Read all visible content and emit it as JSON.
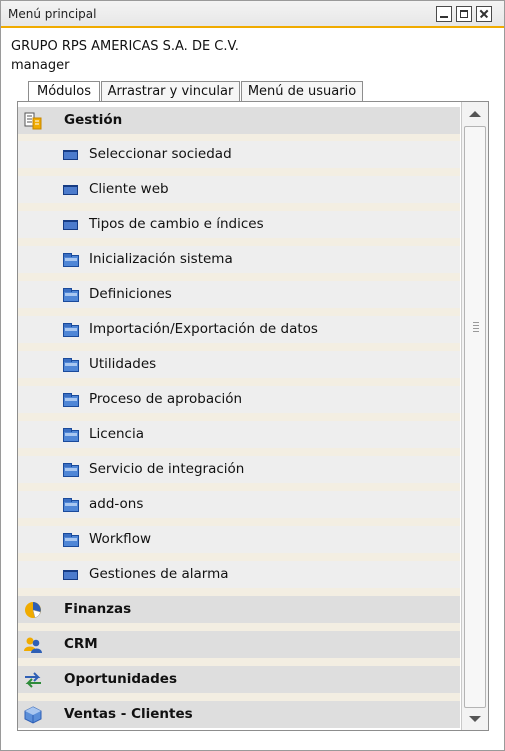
{
  "window": {
    "title": "Menú principal",
    "company": "GRUPO RPS AMERICAS S.A. DE C.V.",
    "user": "manager"
  },
  "tabs": [
    {
      "label": "Módulos",
      "active": true
    },
    {
      "label": "Arrastrar y vincular",
      "active": false
    },
    {
      "label": "Menú de usuario",
      "active": false
    }
  ],
  "modules": {
    "gestion": {
      "label": "Gestión",
      "items": [
        {
          "label": "Seleccionar sociedad",
          "icon": "window-icon"
        },
        {
          "label": "Cliente web",
          "icon": "window-icon"
        },
        {
          "label": "Tipos de cambio e índices",
          "icon": "window-icon"
        },
        {
          "label": "Inicialización sistema",
          "icon": "folder-icon"
        },
        {
          "label": "Definiciones",
          "icon": "folder-icon"
        },
        {
          "label": "Importación/Exportación de datos",
          "icon": "folder-icon"
        },
        {
          "label": "Utilidades",
          "icon": "folder-icon"
        },
        {
          "label": "Proceso de aprobación",
          "icon": "folder-icon"
        },
        {
          "label": "Licencia",
          "icon": "folder-icon"
        },
        {
          "label": "Servicio de integración",
          "icon": "folder-icon"
        },
        {
          "label": "add-ons",
          "icon": "folder-icon"
        },
        {
          "label": "Workflow",
          "icon": "folder-icon"
        },
        {
          "label": "Gestiones de alarma",
          "icon": "window-icon"
        }
      ]
    },
    "others": [
      {
        "label": "Finanzas",
        "icon": "pie-chart-icon"
      },
      {
        "label": "CRM",
        "icon": "users-icon"
      },
      {
        "label": "Oportunidades",
        "icon": "arrows-icon"
      },
      {
        "label": "Ventas - Clientes",
        "icon": "customer-cube-icon"
      }
    ]
  },
  "colors": {
    "accent": "#f0ab00",
    "category_bg": "#dedede",
    "folder": "#4f86d6"
  }
}
